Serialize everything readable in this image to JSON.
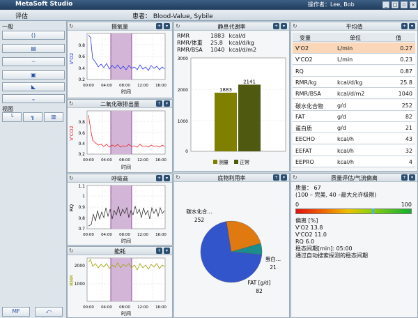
{
  "window": {
    "app_title": "MetaSoft Studio",
    "operator": "操作者：Lee, Bob"
  },
  "header": {
    "section": "评估",
    "patient": "患者：  Blood-Value, Sybile"
  },
  "sidebar": {
    "group1_label": "一般",
    "buttons": [
      "()",
      "▤",
      "┈",
      "▣",
      "◣",
      "⌄"
    ],
    "group2_label": "视图",
    "view_buttons": [
      "└",
      "╗",
      "▥"
    ],
    "bottom_left": "MF",
    "bottom_right": "⤺"
  },
  "panels": {
    "vo2": {
      "title": "摄氧量",
      "ylabel": "V'O2",
      "xlabel": "时间",
      "yticks": [
        "0.8",
        "0.6",
        "0.4",
        "0.2"
      ],
      "xticks": [
        "00:00",
        "04:00",
        "08:00",
        "12:00",
        "16:00"
      ]
    },
    "vco2": {
      "title": "二氧化碳排出量",
      "ylabel": "V'CO2",
      "xlabel": "时间",
      "yticks": [
        "0.8",
        "0.6",
        "0.4",
        "0.2"
      ],
      "xticks": [
        "00:00",
        "04:00",
        "08:00",
        "12:00",
        "16:00"
      ]
    },
    "rq": {
      "title": "呼吸商",
      "ylabel": "RQ",
      "xlabel": "时间",
      "yticks": [
        "1.1",
        "1",
        "0.9",
        "0.8",
        "0.7"
      ],
      "xticks": [
        "00:00",
        "04:00",
        "08:00",
        "12:00",
        "16:00"
      ]
    },
    "ee": {
      "title": "能耗",
      "ylabel": "RMR",
      "xlabel": "时间",
      "yticks": [
        "2000",
        "1000"
      ],
      "xticks": [
        "00:00",
        "04:00",
        "08:00",
        "12:00",
        "16:00"
      ]
    },
    "rmr": {
      "title": "静息代谢率",
      "lines": [
        {
          "label": "RMR",
          "value": "1883",
          "unit": "kcal/d"
        },
        {
          "label": "RMR/体重",
          "value": "25.8",
          "unit": "kcal/d/kg"
        },
        {
          "label": "RMR/BSA",
          "value": "1040",
          "unit": "kcal/d/m2"
        }
      ],
      "yticks": [
        "3000",
        "2000",
        "1000",
        "0"
      ],
      "legend": [
        "测量",
        "正常"
      ],
      "colors": {
        "measured": "#808000",
        "normal": "#4f5a10"
      }
    },
    "substrate": {
      "title": "底物利用率",
      "labels": {
        "cho_name": "碳水化合...",
        "cho_val": "252",
        "prot_name": "蛋白...",
        "prot_val": "21",
        "fat_name": "FAT [g/d]",
        "fat_val": "82"
      }
    },
    "avg": {
      "title": "平均值",
      "headers": [
        "变量",
        "单位",
        "值"
      ],
      "rows": [
        {
          "var": "V'O2",
          "unit": "L/min",
          "val": "0.27"
        },
        {
          "var": "V'CO2",
          "unit": "L/min",
          "val": "0.23"
        },
        {
          "var": "RQ",
          "unit": "",
          "val": "0.87"
        },
        {
          "var": "RMR/kg",
          "unit": "kcal/d/kg",
          "val": "25.8"
        },
        {
          "var": "RMR/BSA",
          "unit": "kcal/d/m2",
          "val": "1040"
        },
        {
          "var": "碳水化合物",
          "unit": "g/d",
          "val": "252"
        },
        {
          "var": "FAT",
          "unit": "g/d",
          "val": "82"
        },
        {
          "var": "蛋白质",
          "unit": "g/d",
          "val": "21"
        },
        {
          "var": "EECHO",
          "unit": "kcal/h",
          "val": "43"
        },
        {
          "var": "EEFAT",
          "unit": "kcal/h",
          "val": "32"
        },
        {
          "var": "EEPRO",
          "unit": "kcal/h",
          "val": "4"
        }
      ]
    },
    "quality": {
      "title": "质量评估/气流偏离",
      "quality_line": "质量： 67",
      "range_line": "(100 – 完美, 40 –最大允许极限)",
      "scale_min": "0",
      "scale_max": "100",
      "quality_value": 67,
      "dev_header": "偏离    [%]",
      "dev_rows": [
        "V'O2   13.8",
        "V'CO2  11.0",
        "RQ      6.0"
      ],
      "steady": "稳态间期[min]: 05:00",
      "auto": "通过自动搜索探测的稳态间期"
    }
  },
  "chart_data": [
    {
      "type": "bar",
      "title": "静息代谢率",
      "categories": [
        "测量",
        "正常"
      ],
      "values": [
        1883,
        2141
      ],
      "ylim": [
        0,
        3000
      ]
    },
    {
      "type": "pie",
      "title": "底物利用率",
      "categories": [
        "碳水化合...",
        "FAT [g/d]",
        "蛋白..."
      ],
      "values": [
        252,
        82,
        21
      ],
      "colors": [
        "#3355cc",
        "#e07a10",
        "#1c8c8c"
      ]
    }
  ]
}
